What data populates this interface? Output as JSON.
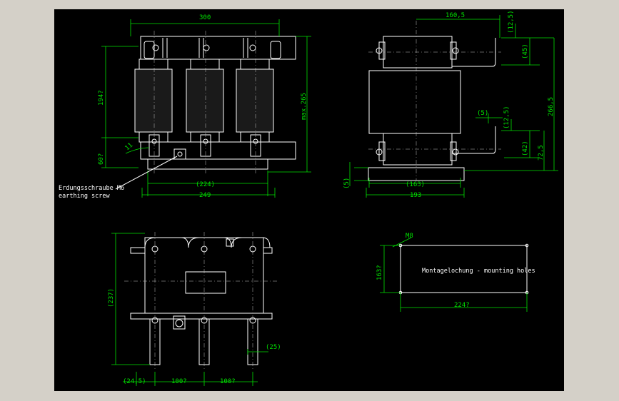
{
  "colors": {
    "background": "#000000",
    "dimension": "#00e000",
    "geometry": "#ffffff",
    "window": "#d4d0c8"
  },
  "front_view": {
    "dim_top": "300",
    "dim_left_upper": "194?",
    "dim_left_lower": "60?",
    "dim_right": "max.265",
    "dim_angle": "11",
    "dim_bottom_inner": "(224)",
    "dim_bottom_outer": "249",
    "label_line1": "Erdungsschraube M6",
    "label_line2": "earthing screw"
  },
  "side_view": {
    "dim_top": "160,5",
    "dim_top_right": "(12,5)",
    "dim_upper_right": "(45)",
    "dim_overall_right": "266,5",
    "dim_mid_left": "(5)",
    "dim_mid_right": "(12,5)",
    "dim_lower_right1": "(42)",
    "dim_lower_right2": "72,5",
    "dim_base_left": "(5)",
    "dim_bottom_inner": "(163)",
    "dim_bottom_outer": "193"
  },
  "top_view": {
    "dim_left": "(237)",
    "dim_right": "(25)",
    "dim_bottom_1": "(24,5)",
    "dim_bottom_2": "100?",
    "dim_bottom_3": "100?"
  },
  "mounting": {
    "label_m8": "M8",
    "dim_left": "163?",
    "dim_bottom": "224?",
    "caption": "Montagelochung - mounting holes"
  }
}
